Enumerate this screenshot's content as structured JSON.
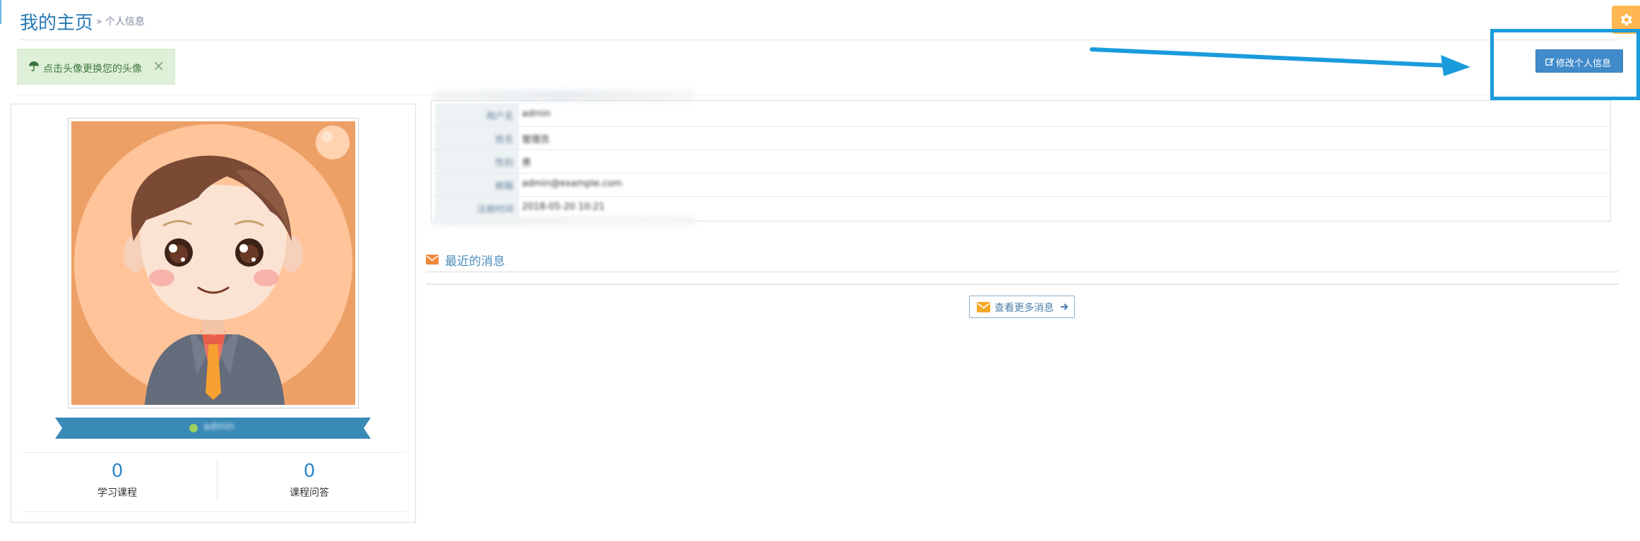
{
  "header": {
    "title": "我的主页",
    "breadcrumb": "» 个人信息"
  },
  "alert": {
    "message": "点击头像更换您的头像",
    "icon": "umbrella-icon",
    "close": "×"
  },
  "actions": {
    "edit_profile": "修改个人信息"
  },
  "profile": {
    "username": "admin",
    "stats": [
      {
        "value": "0",
        "label": "学习课程"
      },
      {
        "value": "0",
        "label": "课程问答"
      }
    ]
  },
  "info_table": {
    "rows": [
      {
        "label": "用户名",
        "value": "admin"
      },
      {
        "label": "姓名",
        "value": "管理员"
      },
      {
        "label": "性别",
        "value": "男"
      },
      {
        "label": "邮箱",
        "value": "admin@example.com"
      },
      {
        "label": "注册时间",
        "value": "2018-05-20 10:21"
      }
    ]
  },
  "messages": {
    "title": "最近的消息",
    "more_button": "查看更多消息"
  },
  "colors": {
    "primary": "#428bca",
    "title_blue": "#2679b5",
    "alert_green_bg": "#dff0d8",
    "warning_orange": "#ffb752",
    "annotation_blue": "#1a9bdc",
    "ribbon_blue": "#3a8ab7"
  }
}
